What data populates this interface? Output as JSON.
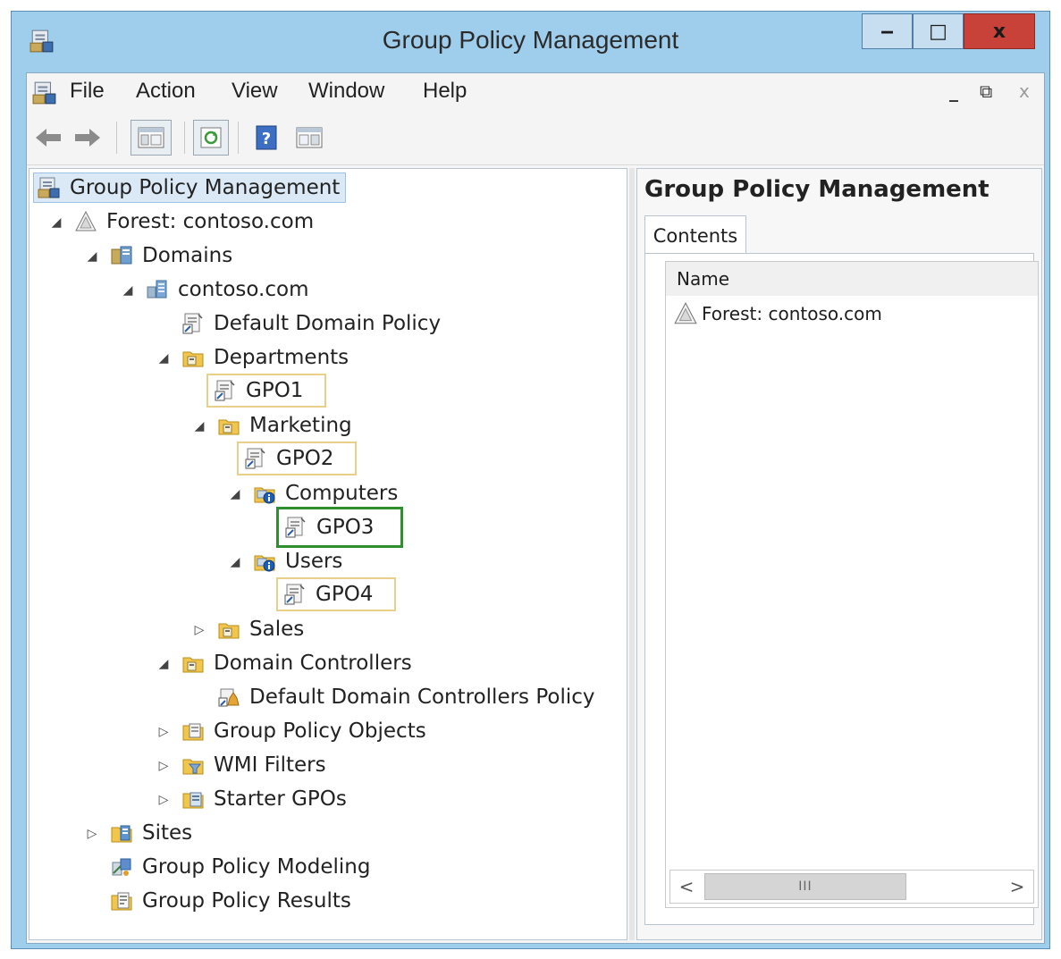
{
  "window": {
    "title": "Group Policy Management",
    "minimize": "‒",
    "maximize": "□",
    "close": "x"
  },
  "menu": [
    "File",
    "Action",
    "View",
    "Window",
    "Help"
  ],
  "mdi_controls": {
    "minimize": "_",
    "restore": "⧉",
    "close": "x"
  },
  "tree": {
    "root": "Group Policy Management",
    "forest": "Forest: contoso.com",
    "domains": "Domains",
    "domain": "contoso.com",
    "default_domain_policy": "Default Domain Policy",
    "departments": "Departments",
    "gpo1": "GPO1",
    "marketing": "Marketing",
    "gpo2": "GPO2",
    "computers": "Computers",
    "gpo3": "GPO3",
    "users": "Users",
    "gpo4": "GPO4",
    "sales": "Sales",
    "domain_controllers": "Domain Controllers",
    "default_dc_policy": "Default Domain Controllers Policy",
    "gpo_objects": "Group Policy Objects",
    "wmi_filters": "WMI Filters",
    "starter_gpos": "Starter GPOs",
    "sites": "Sites",
    "modeling": "Group Policy Modeling",
    "results": "Group Policy Results"
  },
  "right_pane": {
    "title": "Group Policy Management",
    "tab": "Contents",
    "column": "Name",
    "rows": [
      "Forest: contoso.com"
    ],
    "scroll_left": "<",
    "scroll_right": ">",
    "scroll_grip": "III"
  },
  "colors": {
    "titlebar": "#9fcdec",
    "close": "#c8423a",
    "gpo3_highlight": "#2f8f2f",
    "gpo_highlight": "#e9cf8a"
  }
}
